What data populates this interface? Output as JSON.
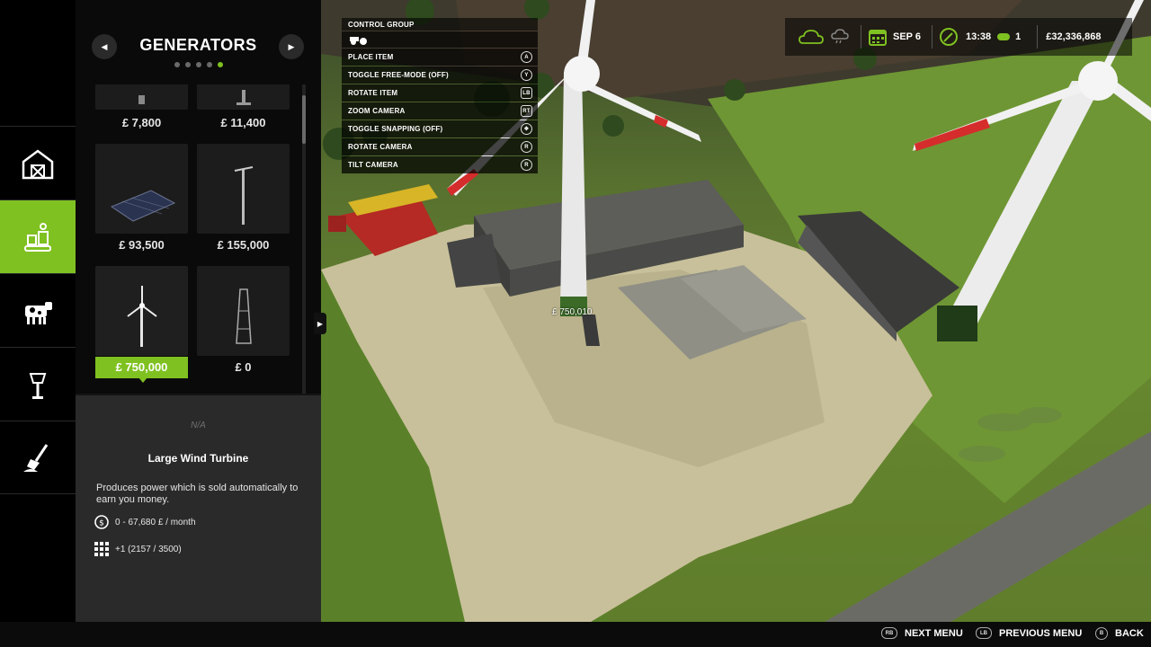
{
  "store": {
    "category_title": "GENERATORS",
    "prev_label": "◀",
    "next_label": "▶",
    "page_count": 5,
    "active_page": 5,
    "items": [
      {
        "price": "£ 7,800",
        "icon": "partial-generator-thumb"
      },
      {
        "price": "£ 11,400",
        "icon": "partial-generator-thumb"
      },
      {
        "price": "£ 93,500",
        "icon": "solar-panel-thumb"
      },
      {
        "price": "£ 155,000",
        "icon": "power-pole-thumb"
      },
      {
        "price": "£ 750,000",
        "icon": "large-wind-turbine-thumb",
        "selected": true
      },
      {
        "price": "£ 0",
        "icon": "lattice-tower-thumb"
      }
    ]
  },
  "details": {
    "availability": "N/A",
    "name": "Large Wind Turbine",
    "description": "Produces power which is sold automatically to earn you money.",
    "income": "0 - 67,680 £ / month",
    "slots": "+1 (2157 / 3500)"
  },
  "rail": [
    {
      "name": "buildings",
      "icon": "barn-icon"
    },
    {
      "name": "production",
      "icon": "factory-icon",
      "active": true
    },
    {
      "name": "animals",
      "icon": "cow-icon"
    },
    {
      "name": "decoration",
      "icon": "lamp-icon"
    },
    {
      "name": "landscaping",
      "icon": "shovel-icon"
    }
  ],
  "controls": {
    "title": "CONTROL GROUP",
    "rows": [
      {
        "label": "PLACE ITEM",
        "key": "A"
      },
      {
        "label": "TOGGLE FREE-MODE (OFF)",
        "key": "Y"
      },
      {
        "label": "ROTATE ITEM",
        "key": "LB"
      },
      {
        "label": "ZOOM CAMERA",
        "key": "RT"
      },
      {
        "label": "TOGGLE SNAPPING (OFF)",
        "key": "✥"
      },
      {
        "label": "ROTATE CAMERA",
        "key": "R"
      },
      {
        "label": "TILT CAMERA",
        "key": "R"
      }
    ]
  },
  "hud": {
    "date": "SEP 6",
    "time": "13:38",
    "speed": "1",
    "money": "£32,336,868"
  },
  "placement": {
    "price_tag": "£ 750,010"
  },
  "bottom": [
    {
      "key": "RB",
      "label": "NEXT MENU"
    },
    {
      "key": "LB",
      "label": "PREVIOUS MENU"
    },
    {
      "key": "B",
      "label": "BACK"
    }
  ],
  "colors": {
    "accent": "#7fc121",
    "panel_bg": "#141414",
    "details_bg": "#2a2a2a"
  }
}
